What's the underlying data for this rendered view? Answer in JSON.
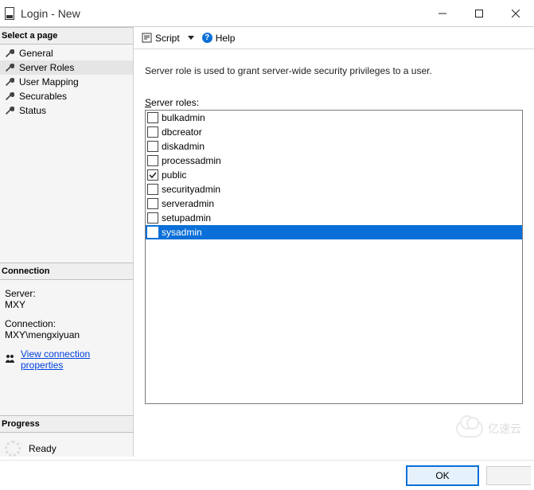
{
  "window": {
    "title": "Login - New"
  },
  "left": {
    "select_page": "Select a page",
    "pages": [
      {
        "label": "General",
        "selected": false
      },
      {
        "label": "Server Roles",
        "selected": true
      },
      {
        "label": "User Mapping",
        "selected": false
      },
      {
        "label": "Securables",
        "selected": false
      },
      {
        "label": "Status",
        "selected": false
      }
    ],
    "connection_header": "Connection",
    "server_label": "Server:",
    "server_value": "MXY",
    "connection_label": "Connection:",
    "connection_value": "MXY\\mengxiyuan",
    "view_props": "View connection properties",
    "progress_header": "Progress",
    "ready": "Ready"
  },
  "toolbar": {
    "script": "Script",
    "help": "Help"
  },
  "main": {
    "description": "Server role is used to grant server-wide security privileges to a user.",
    "roles_label_prefix": "S",
    "roles_label_rest": "erver roles:",
    "roles": [
      {
        "name": "bulkadmin",
        "checked": false,
        "selected": false
      },
      {
        "name": "dbcreator",
        "checked": false,
        "selected": false
      },
      {
        "name": "diskadmin",
        "checked": false,
        "selected": false
      },
      {
        "name": "processadmin",
        "checked": false,
        "selected": false
      },
      {
        "name": "public",
        "checked": true,
        "selected": false
      },
      {
        "name": "securityadmin",
        "checked": false,
        "selected": false
      },
      {
        "name": "serveradmin",
        "checked": false,
        "selected": false
      },
      {
        "name": "setupadmin",
        "checked": false,
        "selected": false
      },
      {
        "name": "sysadmin",
        "checked": true,
        "selected": true
      }
    ]
  },
  "footer": {
    "ok": "OK"
  },
  "watermark": "亿速云"
}
